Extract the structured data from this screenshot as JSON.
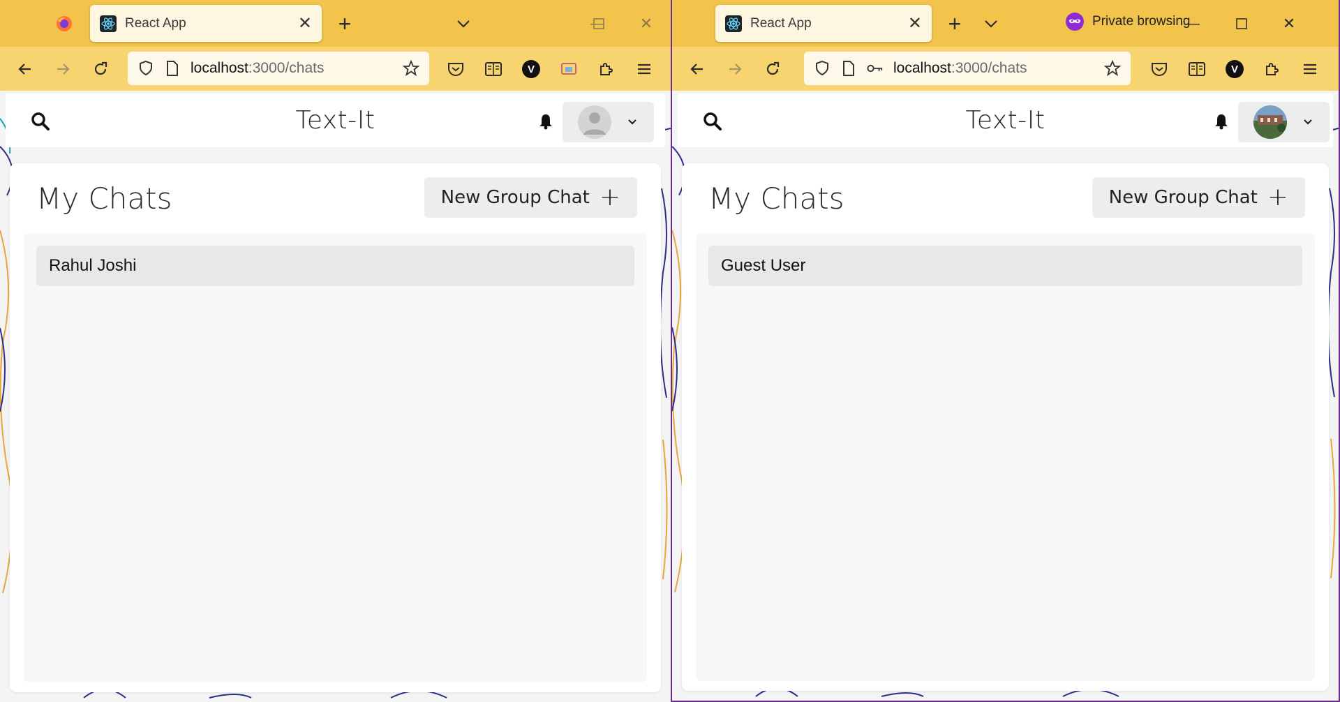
{
  "left_window": {
    "tab": {
      "title": "React App",
      "close_glyph": "✕"
    },
    "tabbar": {
      "new_tab_glyph": "+",
      "list_tabs_glyph": "⌄",
      "minimize_glyph": "—",
      "maximize_glyph": "☐",
      "close_glyph": "✕"
    },
    "url": {
      "host": "localhost",
      "path": ":3000/chats"
    },
    "app": {
      "title": "Text-It",
      "heading": "My Chats",
      "new_group_label": "New Group Chat",
      "new_group_glyph": "+"
    },
    "chats": [
      "Rahul Joshi"
    ]
  },
  "right_window": {
    "tab": {
      "title": "React App",
      "close_glyph": "✕"
    },
    "tabbar": {
      "new_tab_glyph": "+",
      "list_tabs_glyph": "⌄",
      "minimize_glyph": "—",
      "maximize_glyph": "☐",
      "close_glyph": "✕",
      "private_label": "Private browsing"
    },
    "url": {
      "host": "localhost",
      "path": ":3000/chats"
    },
    "app": {
      "title": "Text-It",
      "heading": "My Chats",
      "new_group_label": "New Group Chat",
      "new_group_glyph": "+"
    },
    "chats": [
      "Guest User"
    ]
  },
  "icons": {
    "back": "arrow-left-icon",
    "forward": "arrow-right-icon",
    "reload": "reload-icon",
    "shield": "shield-icon",
    "page": "page-icon",
    "key": "key-icon",
    "star": "star-icon",
    "pocket": "pocket-icon",
    "reader": "reader-view-icon",
    "extensions": "puzzle-icon",
    "menu": "hamburger-menu-icon",
    "search": "search-icon",
    "bell": "bell-icon"
  },
  "colors": {
    "tabbar": "#f2c44c",
    "navbar": "#f7d46f",
    "private_accent": "#8e2ad6"
  }
}
